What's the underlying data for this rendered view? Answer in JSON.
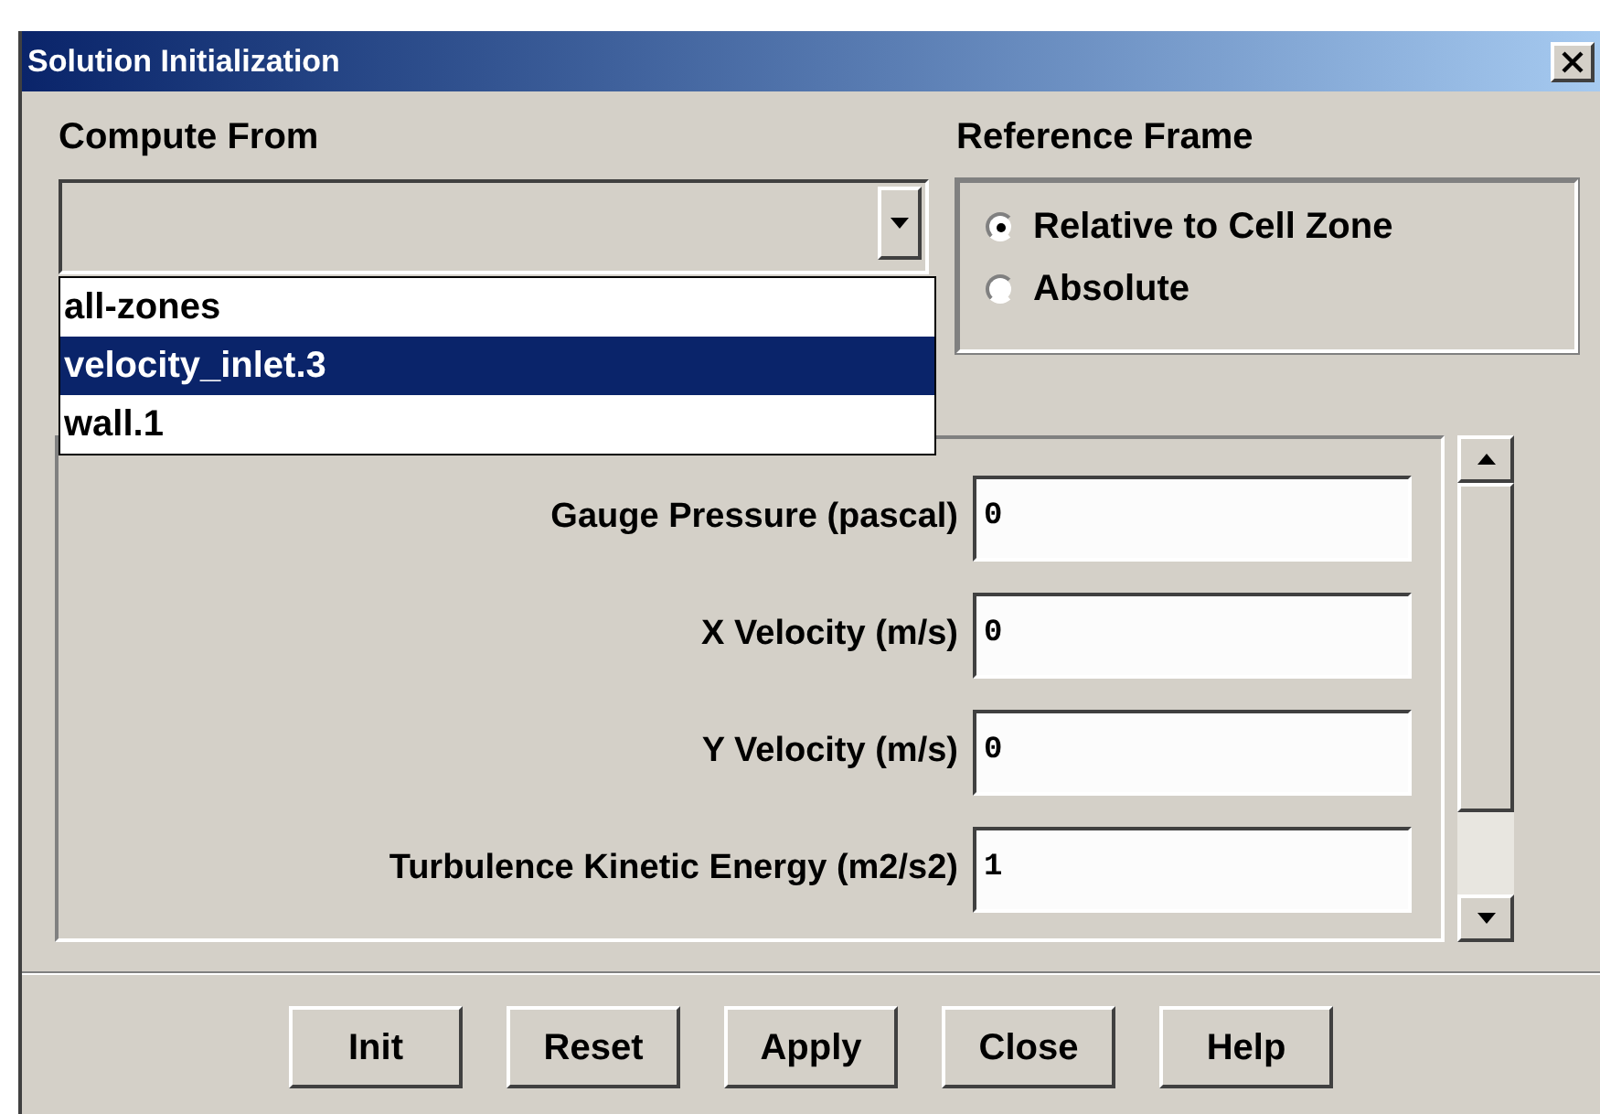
{
  "window": {
    "title": "Solution Initialization"
  },
  "compute_from": {
    "label": "Compute From",
    "expanded": true,
    "options": [
      {
        "label": "all-zones",
        "selected": false
      },
      {
        "label": "velocity_inlet.3",
        "selected": true
      },
      {
        "label": "wall.1",
        "selected": false
      }
    ]
  },
  "reference_frame": {
    "label": "Reference Frame",
    "options": [
      {
        "label": "Relative to Cell Zone",
        "selected": true
      },
      {
        "label": "Absolute",
        "selected": false
      }
    ]
  },
  "initial_values": [
    {
      "label": "Gauge Pressure (pascal)",
      "value": "0"
    },
    {
      "label": "X Velocity (m/s)",
      "value": "0"
    },
    {
      "label": "Y Velocity (m/s)",
      "value": "0"
    },
    {
      "label": "Turbulence Kinetic Energy (m2/s2)",
      "value": "1"
    }
  ],
  "buttons": [
    "Init",
    "Reset",
    "Apply",
    "Close",
    "Help"
  ]
}
